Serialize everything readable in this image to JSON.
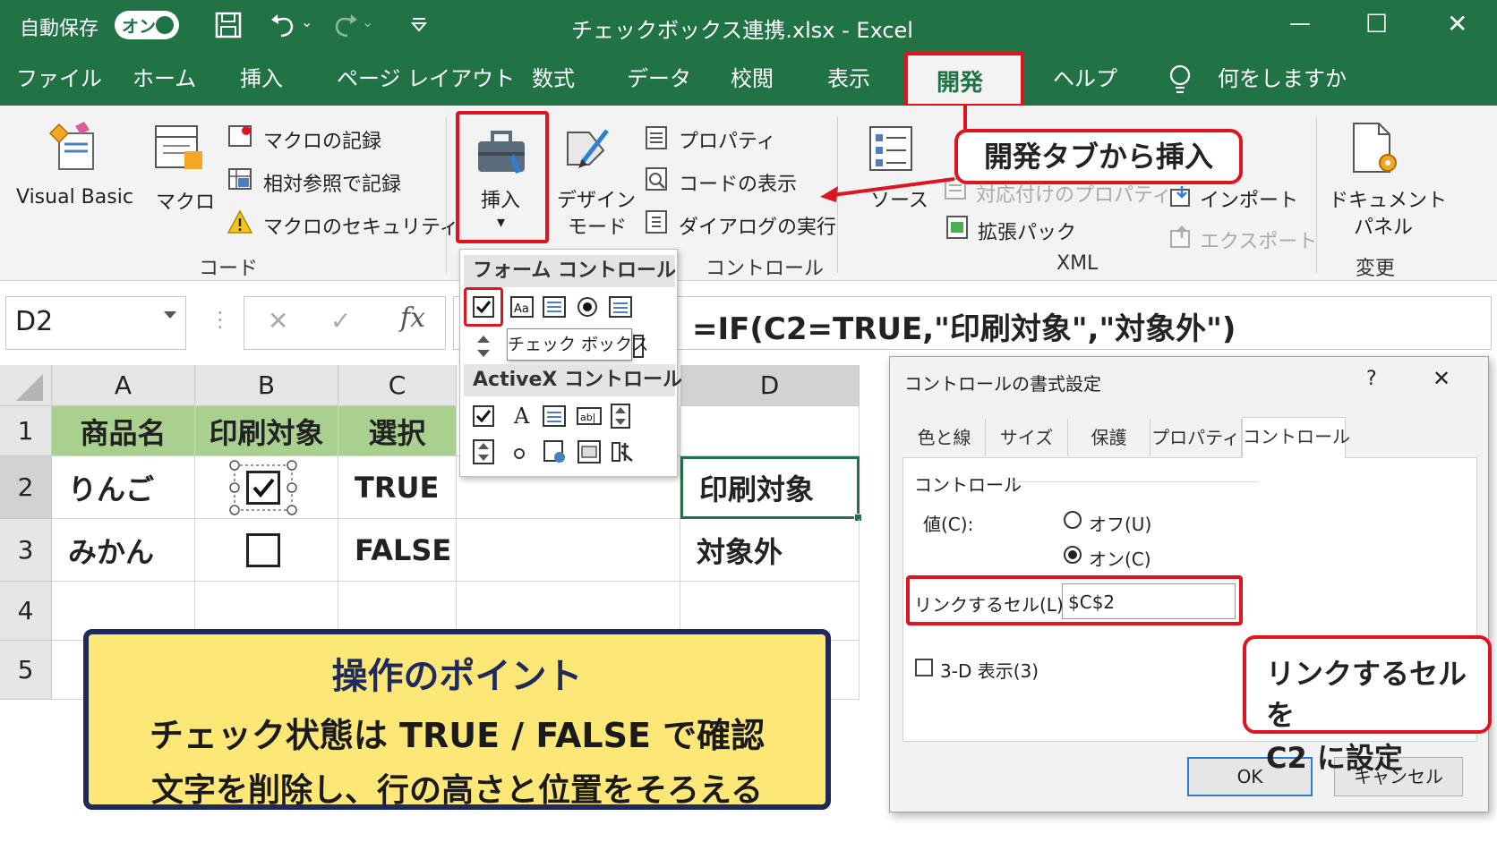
{
  "titlebar": {
    "autosave_label": "自動保存",
    "autosave_toggle": "オン",
    "document_title": "チェックボックス連携.xlsx - Excel",
    "dropdown_glyph": "⌄",
    "minimize_glyph": "—",
    "maximize_glyph": "☐",
    "close_glyph": "✕"
  },
  "tabs": [
    {
      "label": "ファイル"
    },
    {
      "label": "ホーム"
    },
    {
      "label": "挿入"
    },
    {
      "label": "ページ レイアウト"
    },
    {
      "label": "数式"
    },
    {
      "label": "データ"
    },
    {
      "label": "校閲"
    },
    {
      "label": "表示"
    },
    {
      "label": "開発"
    },
    {
      "label": "ヘルプ"
    },
    {
      "label": "何をしますか"
    }
  ],
  "ribbon": {
    "visual_basic": "Visual Basic",
    "macro": "マクロ",
    "record_macro": "マクロの記録",
    "relative_ref": "相対参照で記録",
    "macro_security": "マクロのセキュリティ",
    "group_code": "コード",
    "insert": "挿入",
    "insert_arrow": "▾",
    "design_mode": "デザイン",
    "design_mode2": "モード",
    "properties": "プロパティ",
    "view_code": "コードの表示",
    "run_dialog": "ダイアログの実行",
    "group_controls": "コントロール",
    "source": "ソース",
    "map_properties": "対応付けのプロパティ",
    "expansion_pack": "拡張パック",
    "import": "インポート",
    "export": "エクスポート",
    "group_xml": "XML",
    "document_panel": "ドキュメント",
    "document_panel2": "パネル",
    "group_modify": "変更"
  },
  "dropdown": {
    "form_controls_header": "フォーム コントロール",
    "activex_header": "ActiveX コントロール",
    "tooltip": "チェック ボックス"
  },
  "formula_bar": {
    "name_box": "D2",
    "cancel_glyph": "✕",
    "enter_glyph": "✓",
    "fx_glyph": "fx",
    "formula": "=IF(C2=TRUE,\"印刷対象\",\"対象外\")"
  },
  "sheet": {
    "columns": [
      "A",
      "B",
      "C",
      "D"
    ],
    "rows": [
      "1",
      "2",
      "3",
      "4",
      "5"
    ],
    "headers": [
      "商品名",
      "印刷対象",
      "選択"
    ],
    "row2": {
      "a": "りんご",
      "c": "TRUE",
      "d": "印刷対象",
      "checked": true
    },
    "row3": {
      "a": "みかん",
      "c": "FALSE",
      "d": "対象外",
      "checked": false
    }
  },
  "callouts": {
    "insert_from_dev_tab": "開発タブから挿入",
    "link_cell_line1": "リンクするセルを",
    "link_cell_line2": "C2 に設定"
  },
  "dialog": {
    "title": "コントロールの書式設定",
    "help_glyph": "?",
    "close_glyph": "✕",
    "tabs": [
      "色と線",
      "サイズ",
      "保護",
      "プロパティ",
      "コントロール"
    ],
    "section": "コントロール",
    "value_label": "値(C):",
    "off_label": "オフ(U)",
    "on_label": "オン(C)",
    "link_cell_label": "リンクするセル(L):",
    "link_cell_value": "$C$2",
    "three_d_label": "3-D 表示(3)",
    "ok": "OK",
    "cancel": "キャンセル"
  },
  "point_box": {
    "title": "操作のポイント",
    "line1": "チェック状態は TRUE / FALSE で確認",
    "line2": "文字を削除し、行の高さと位置をそろえる"
  },
  "colors": {
    "excel_green": "#217346",
    "highlight_red": "#e0141e",
    "header_fill": "#a9d08e",
    "point_fill": "#fde877",
    "point_border": "#1f2a5c"
  }
}
